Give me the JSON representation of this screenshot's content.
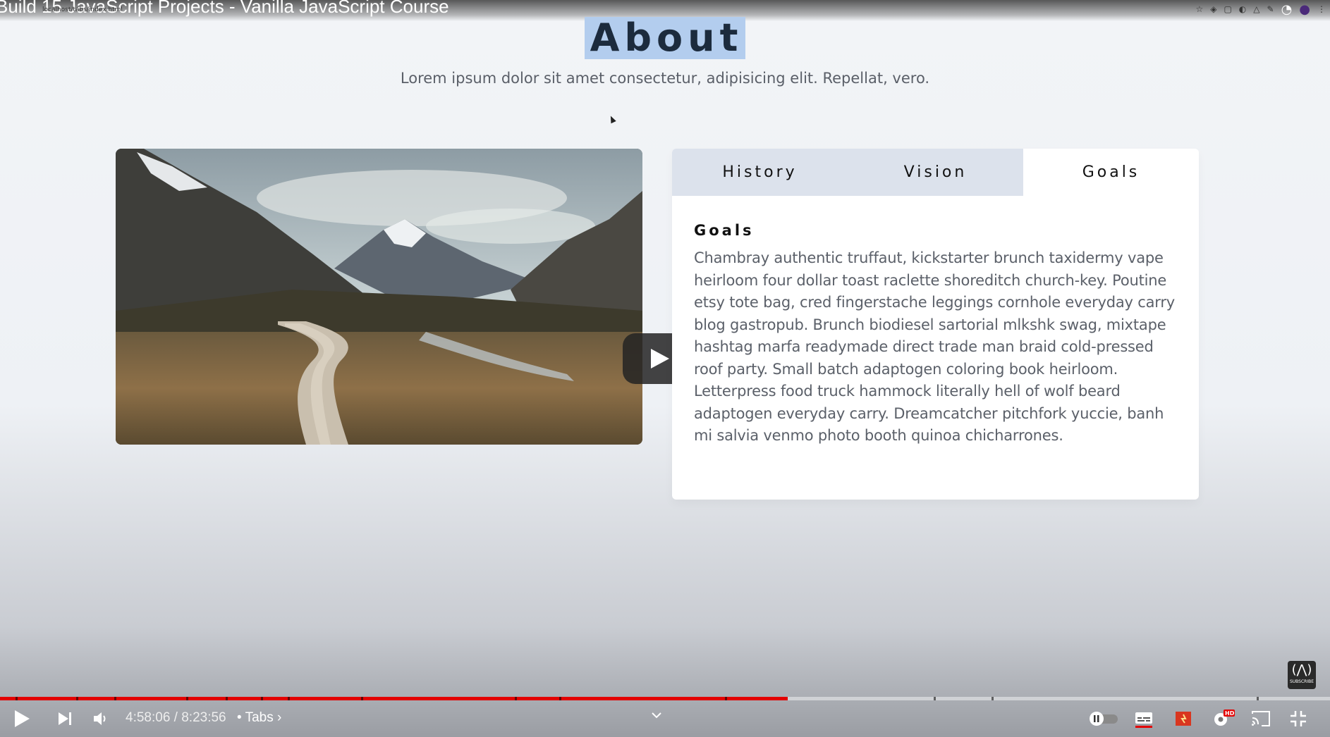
{
  "browser": {
    "video_title": "Build 15 JavaScript Projects - Vanilla JavaScript Course",
    "url_snippet": "localhost/tabs/index.html"
  },
  "page": {
    "heading": "About",
    "subtitle": "Lorem ipsum dolor sit amet consectetur, adipisicing elit. Repellat, vero."
  },
  "tabs": {
    "items": [
      {
        "label": "History",
        "active": false
      },
      {
        "label": "Vision",
        "active": false
      },
      {
        "label": "Goals",
        "active": true
      }
    ],
    "content_title": "Goals",
    "content_text": "Chambray authentic truffaut, kickstarter brunch taxidermy vape heirloom four dollar toast raclette shoreditch church-key. Poutine etsy tote bag, cred fingerstache leggings cornhole everyday carry blog gastropub. Brunch biodiesel sartorial mlkshk swag, mixtape hashtag marfa readymade direct trade man braid cold-pressed roof party. Small batch adaptogen coloring book heirloom. Letterpress food truck hammock literally hell of wolf beard adaptogen everyday carry. Dreamcatcher pitchfork yuccie, banh mi salvia venmo photo booth quinoa chicharrones."
  },
  "player": {
    "current_time": "4:58:06",
    "duration": "8:23:56",
    "time_display": "4:58:06 / 8:23:56",
    "chapter": "• Tabs ›",
    "progress_fraction": 0.592,
    "badge_text": "SUBSCRIBE",
    "accent_color": "#e30000",
    "icons": [
      "play-icon",
      "next-icon",
      "volume-icon",
      "chapter-expand-icon",
      "autoplay-toggle-icon",
      "subtitles-icon",
      "miniplayer-icon",
      "settings-icon",
      "cast-icon",
      "exit-fullscreen-icon"
    ]
  }
}
